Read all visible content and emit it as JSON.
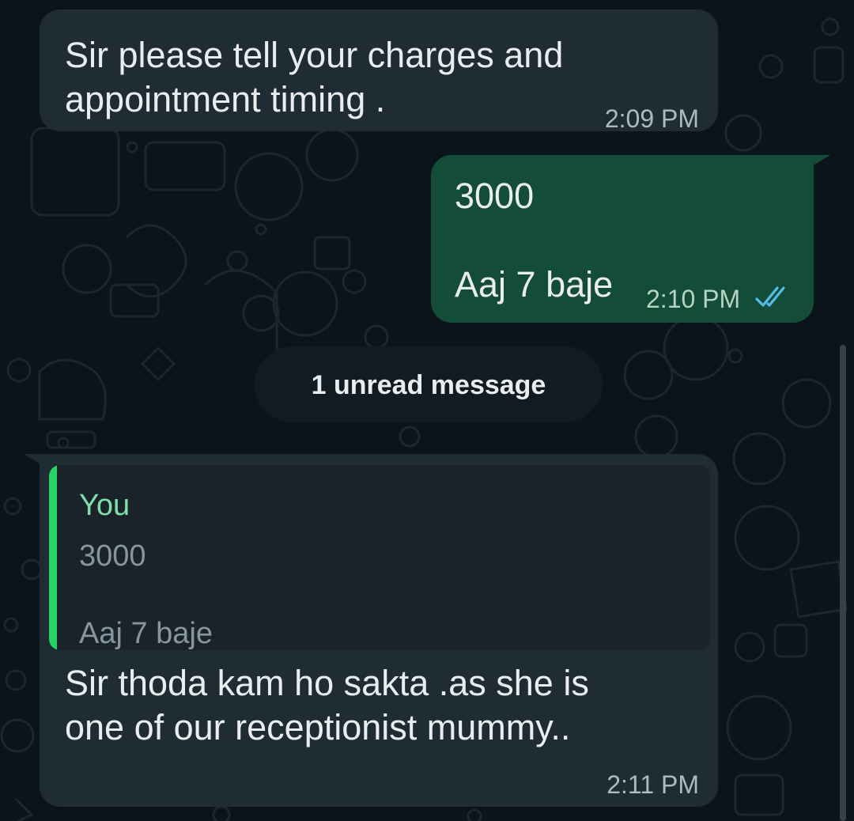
{
  "messages": [
    {
      "direction": "incoming",
      "text": "Sir please tell your charges and\nappointment timing .",
      "time": "2:09 PM"
    },
    {
      "direction": "outgoing",
      "lines": [
        "3000",
        "Aaj 7 baje"
      ],
      "time": "2:10 PM",
      "status": "read",
      "status_icon": "double-check-icon"
    },
    {
      "direction": "incoming",
      "quote": {
        "author": "You",
        "lines": [
          "3000",
          "Aaj 7 baje"
        ]
      },
      "text": "Sir thoda kam ho sakta .as she is\none of our receptionist mummy..",
      "time": "2:11 PM"
    }
  ],
  "unread_divider": "1 unread message",
  "colors": {
    "background": "#0b141a",
    "incoming_bubble": "#202c33",
    "outgoing_bubble": "#144d37",
    "quote_bar": "#25d366",
    "quote_author": "#7ee0a8",
    "read_ticks": "#53bdeb"
  }
}
